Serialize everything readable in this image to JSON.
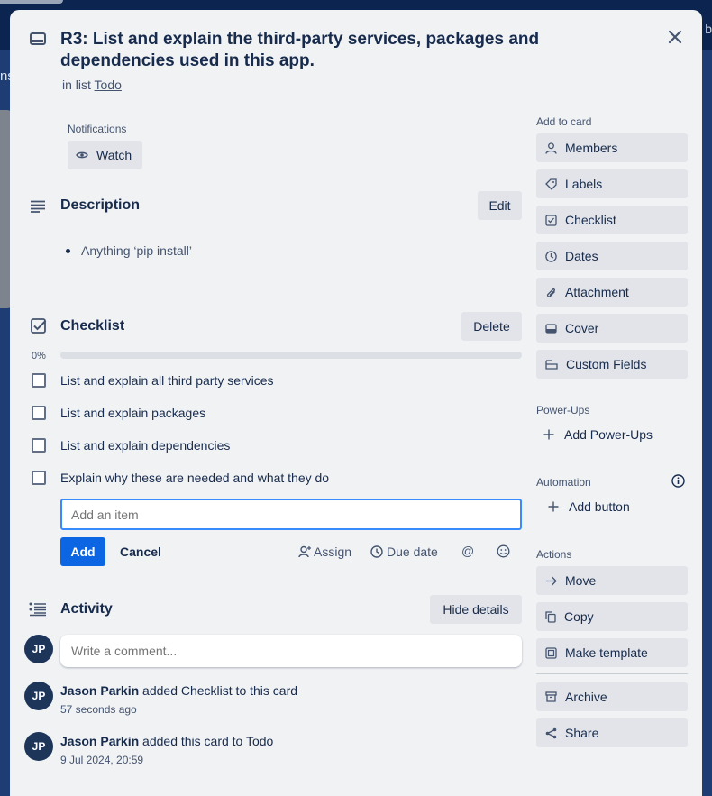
{
  "card": {
    "title": "R3: List and explain the third-party services, packages and dependencies used in this app.",
    "in_list_prefix": "in list",
    "list_name": "Todo"
  },
  "notifications": {
    "label": "Notifications",
    "watch_label": "Watch"
  },
  "description": {
    "title": "Description",
    "edit_label": "Edit",
    "bullets": [
      "Anything ‘pip install’"
    ]
  },
  "checklist": {
    "title": "Checklist",
    "delete_label": "Delete",
    "progress_text": "0%",
    "progress": 0,
    "items": [
      {
        "text": "List and explain all third party services",
        "checked": false
      },
      {
        "text": "List and explain packages",
        "checked": false
      },
      {
        "text": "List and explain dependencies",
        "checked": false
      },
      {
        "text": "Explain why these are needed and what they do",
        "checked": false
      }
    ],
    "add_placeholder": "Add an item",
    "add_label": "Add",
    "cancel_label": "Cancel",
    "assign_label": "Assign",
    "due_label": "Due date",
    "mention_label": "@"
  },
  "activity": {
    "title": "Activity",
    "hide_label": "Hide details",
    "comment_placeholder": "Write a comment...",
    "entries": [
      {
        "initials": "JP",
        "user": "Jason Parkin",
        "action": " added Checklist to this card",
        "time": "57 seconds ago"
      },
      {
        "initials": "JP",
        "user": "Jason Parkin",
        "action": " added this card to Todo",
        "time": "9 Jul 2024, 20:59"
      }
    ],
    "avatar_initials": "JP"
  },
  "sidebar": {
    "add_to_card_label": "Add to card",
    "add_to_card": [
      "Members",
      "Labels",
      "Checklist",
      "Dates",
      "Attachment",
      "Cover",
      "Custom Fields"
    ],
    "powerups_label": "Power-Ups",
    "add_powerups": "Add Power-Ups",
    "automation_label": "Automation",
    "add_button": "Add button",
    "actions_label": "Actions",
    "actions": [
      "Move",
      "Copy",
      "Make template"
    ],
    "archive": "Archive",
    "share": "Share"
  },
  "backdrop": {
    "left_text": "ns",
    "right_text": "c b"
  },
  "colors": {
    "primary": "#0c66e4",
    "modal_bg": "#f1f2f4",
    "button_bg": "#e2e4e9",
    "text": "#172b4d"
  }
}
